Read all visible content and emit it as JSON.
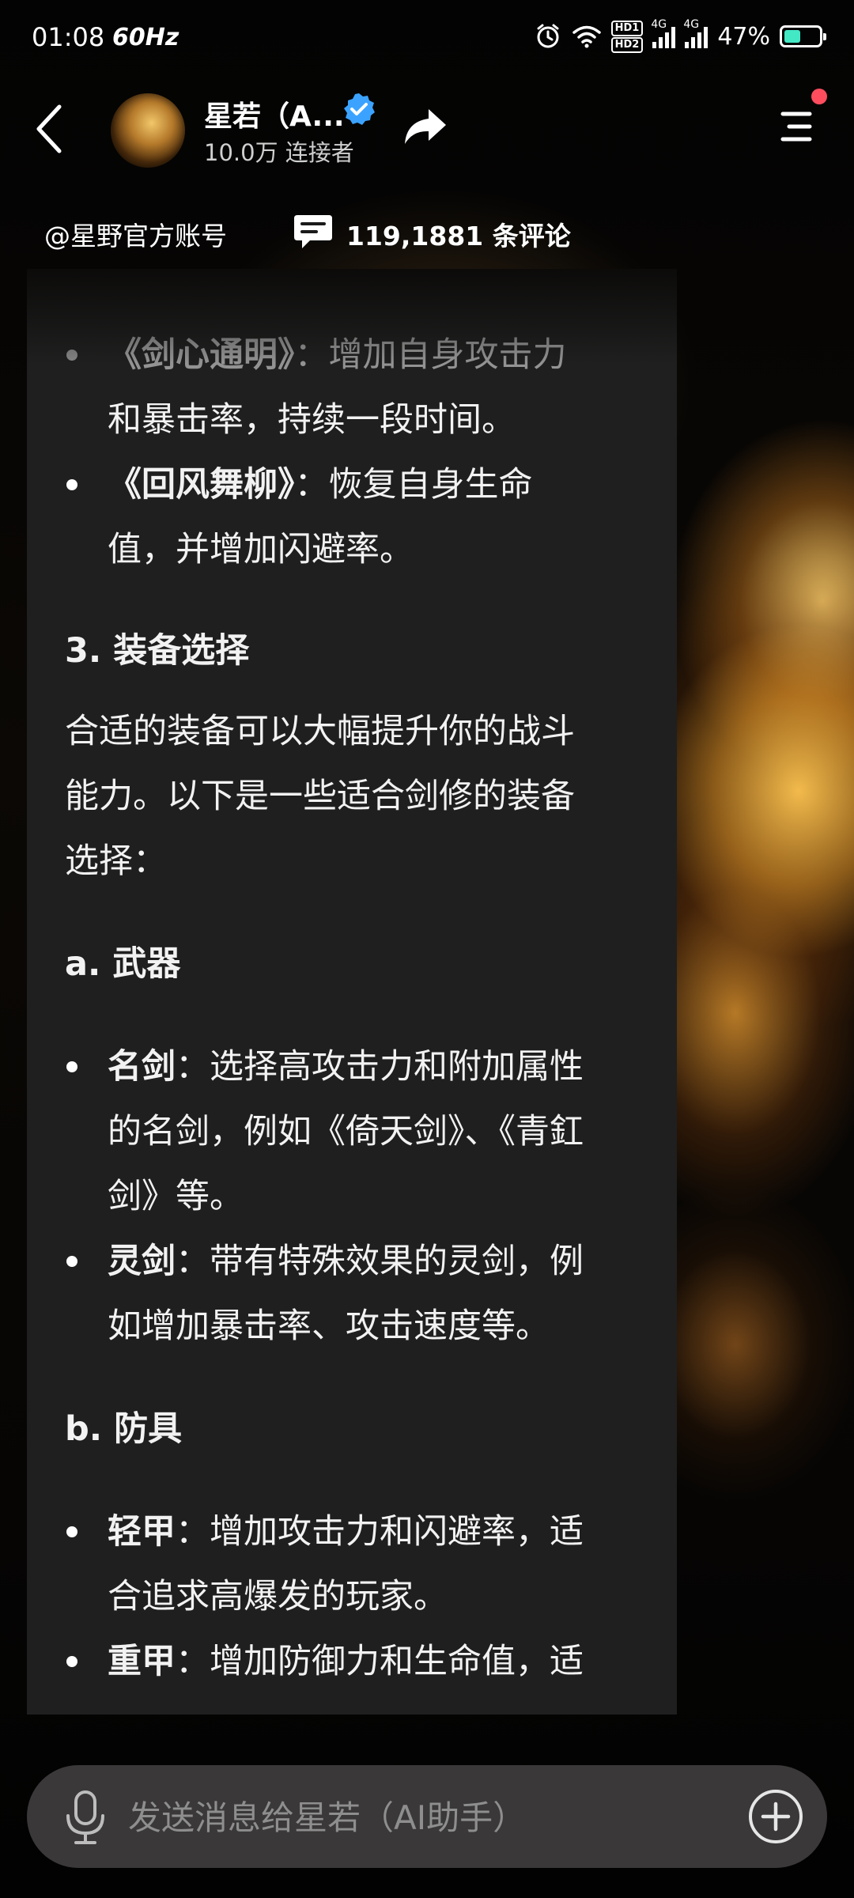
{
  "status_bar": {
    "time": "01:08",
    "refresh_rate": "60Hz",
    "hd_badge_1": "HD1",
    "hd_badge_2": "HD2",
    "network_1": "4G",
    "network_2": "4G",
    "battery_percent": "47%",
    "battery_level": 0.47
  },
  "header": {
    "bot_name": "星若（A...",
    "followers": "10.0万 连接者"
  },
  "info_row": {
    "account": "@星野官方账号",
    "comment_count": "119,1881 条评论"
  },
  "message": {
    "skill1_name": "《剑心通明》",
    "skill1_desc_a": "：增加自身攻击力",
    "skill1_desc_b": "和暴击率，持续一段时间。",
    "skill2_name": "《回风舞柳》",
    "skill2_desc_a": "：恢复自身生命",
    "skill2_desc_b": "值，并增加闪避率。",
    "section3_title": "3. 装备选择",
    "section3_line1": "合适的装备可以大幅提升你的战斗",
    "section3_line2": "能力。以下是一些适合剑修的装备",
    "section3_line3": "选择：",
    "weapons_title": "a. 武器",
    "weapon1_name": "名剑",
    "weapon1_desc_a": "：选择高攻击力和附加属性",
    "weapon1_desc_b": "的名剑，例如《倚天剑》、《青釭",
    "weapon1_desc_c": "剑》等。",
    "weapon2_name": "灵剑",
    "weapon2_desc_a": "：带有特殊效果的灵剑，例",
    "weapon2_desc_b": "如增加暴击率、攻击速度等。",
    "armor_title": "b. 防具",
    "armor1_name": "轻甲",
    "armor1_desc_a": "：增加攻击力和闪避率，适",
    "armor1_desc_b": "合追求高爆发的玩家。",
    "armor2_name": "重甲",
    "armor2_desc_a": "：增加防御力和生命值，适"
  },
  "input": {
    "placeholder": "发送消息给星若（AI助手）"
  },
  "icons": {
    "back": "back-arrow-icon",
    "verified": "verified-badge-icon",
    "share": "share-arrow-icon",
    "menu": "menu-icon",
    "comment": "comment-icon",
    "mic": "microphone-icon",
    "plus": "plus-circle-icon",
    "alarm": "alarm-icon",
    "wifi": "wifi-icon"
  },
  "colors": {
    "accent_blue": "#3ba3ff",
    "notification_red": "#ff4d5e",
    "battery_green": "#43e8c5",
    "card_bg": "#1f1f1f",
    "input_bg": "#3a3838"
  }
}
